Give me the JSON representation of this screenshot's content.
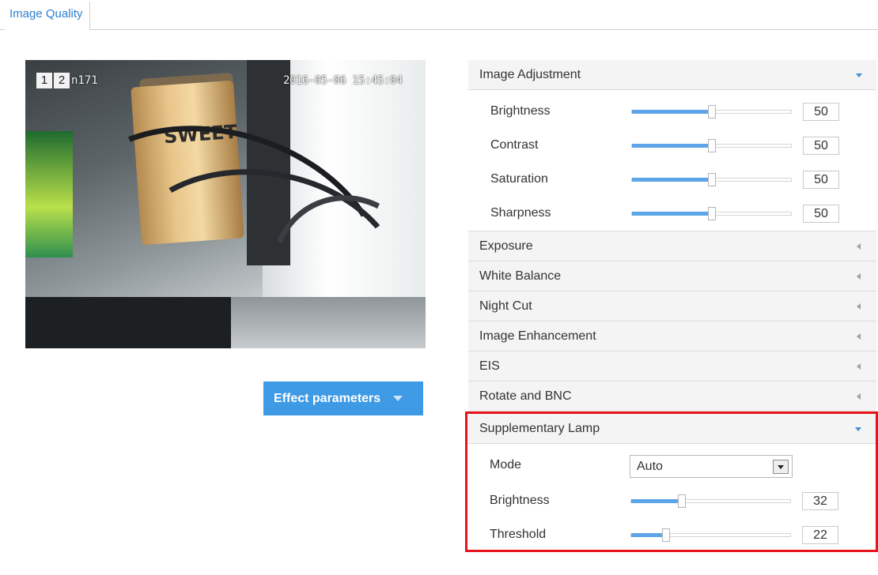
{
  "tab": {
    "label": "Image Quality"
  },
  "video": {
    "channel_boxes": [
      "1",
      "2"
    ],
    "osd_name": "n171",
    "osd_time": "2016-05-06 15:45:04",
    "scene_text": "SWEET"
  },
  "effect_button": {
    "label": "Effect parameters"
  },
  "image_adjustment": {
    "title": "Image Adjustment",
    "expanded": true,
    "rows": [
      {
        "label": "Brightness",
        "value": "50",
        "level_percent": 50
      },
      {
        "label": "Contrast",
        "value": "50",
        "level_percent": 50
      },
      {
        "label": "Saturation",
        "value": "50",
        "level_percent": 50
      },
      {
        "label": "Sharpness",
        "value": "50",
        "level_percent": 50
      }
    ]
  },
  "collapsed_sections": [
    "Exposure",
    "White Balance",
    "Night Cut",
    "Image Enhancement",
    "EIS",
    "Rotate and BNC"
  ],
  "supplementary_lamp": {
    "title": "Supplementary Lamp",
    "expanded": true,
    "mode_label": "Mode",
    "mode_value": "Auto",
    "rows": [
      {
        "label": "Brightness",
        "value": "32",
        "level_percent": 32
      },
      {
        "label": "Threshold",
        "value": "22",
        "level_percent": 22
      }
    ]
  },
  "colors": {
    "accent": "#3f9ae6",
    "slider_fill": "#5ca5e8",
    "highlight_border": "#e8141b",
    "tab_text": "#2f7fcf"
  }
}
